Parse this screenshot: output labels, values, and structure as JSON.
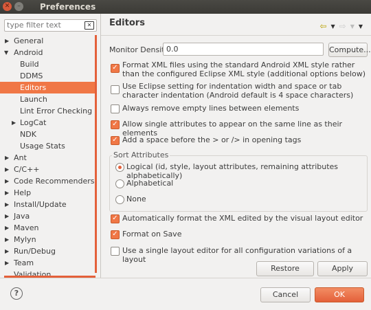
{
  "window": {
    "title": "Preferences"
  },
  "sidebar": {
    "filter_placeholder": "type filter text",
    "items": [
      {
        "label": "General"
      },
      {
        "label": "Android"
      },
      {
        "label": "Build"
      },
      {
        "label": "DDMS"
      },
      {
        "label": "Editors"
      },
      {
        "label": "Launch"
      },
      {
        "label": "Lint Error Checking"
      },
      {
        "label": "LogCat"
      },
      {
        "label": "NDK"
      },
      {
        "label": "Usage Stats"
      },
      {
        "label": "Ant"
      },
      {
        "label": "C/C++"
      },
      {
        "label": "Code Recommenders"
      },
      {
        "label": "Help"
      },
      {
        "label": "Install/Update"
      },
      {
        "label": "Java"
      },
      {
        "label": "Maven"
      },
      {
        "label": "Mylyn"
      },
      {
        "label": "Run/Debug"
      },
      {
        "label": "Team"
      },
      {
        "label": "Validation"
      }
    ],
    "selected": "Editors"
  },
  "page": {
    "title": "Editors",
    "monitor_density_label": "Monitor Density",
    "monitor_density_value": "0.0",
    "compute_label": "Compute...",
    "options": [
      {
        "text": "Format XML files using the standard Android XML style rather than the configured Eclipse XML style (additional options below)",
        "checked": true
      },
      {
        "text": "Use Eclipse setting for indentation width and space or tab character indentation (Android default is 4 space characters)",
        "checked": false
      },
      {
        "text": "Always remove empty lines between elements",
        "checked": false
      },
      {
        "text": "Allow single attributes to appear on the same line as their elements",
        "checked": true
      },
      {
        "text": "Add a space before the > or /> in opening tags",
        "checked": true
      }
    ],
    "sort_attributes": {
      "title": "Sort Attributes",
      "options": [
        {
          "text": "Logical (id, style, layout attributes, remaining attributes alphabetically)",
          "selected": true
        },
        {
          "text": "Alphabetical",
          "selected": false
        },
        {
          "text": "None",
          "selected": false
        }
      ]
    },
    "options2": [
      {
        "text": "Automatically format the XML edited by the visual layout editor",
        "checked": true
      },
      {
        "text": "Format on Save",
        "checked": true
      },
      {
        "text": "Use a single layout editor for all configuration variations of a layout",
        "checked": false
      }
    ],
    "restore_defaults_label": "Restore Defaults",
    "apply_label": "Apply"
  },
  "footer": {
    "cancel_label": "Cancel",
    "ok_label": "OK"
  },
  "colors": {
    "accent": "#f07746",
    "titlebar": "#3b3a36"
  }
}
